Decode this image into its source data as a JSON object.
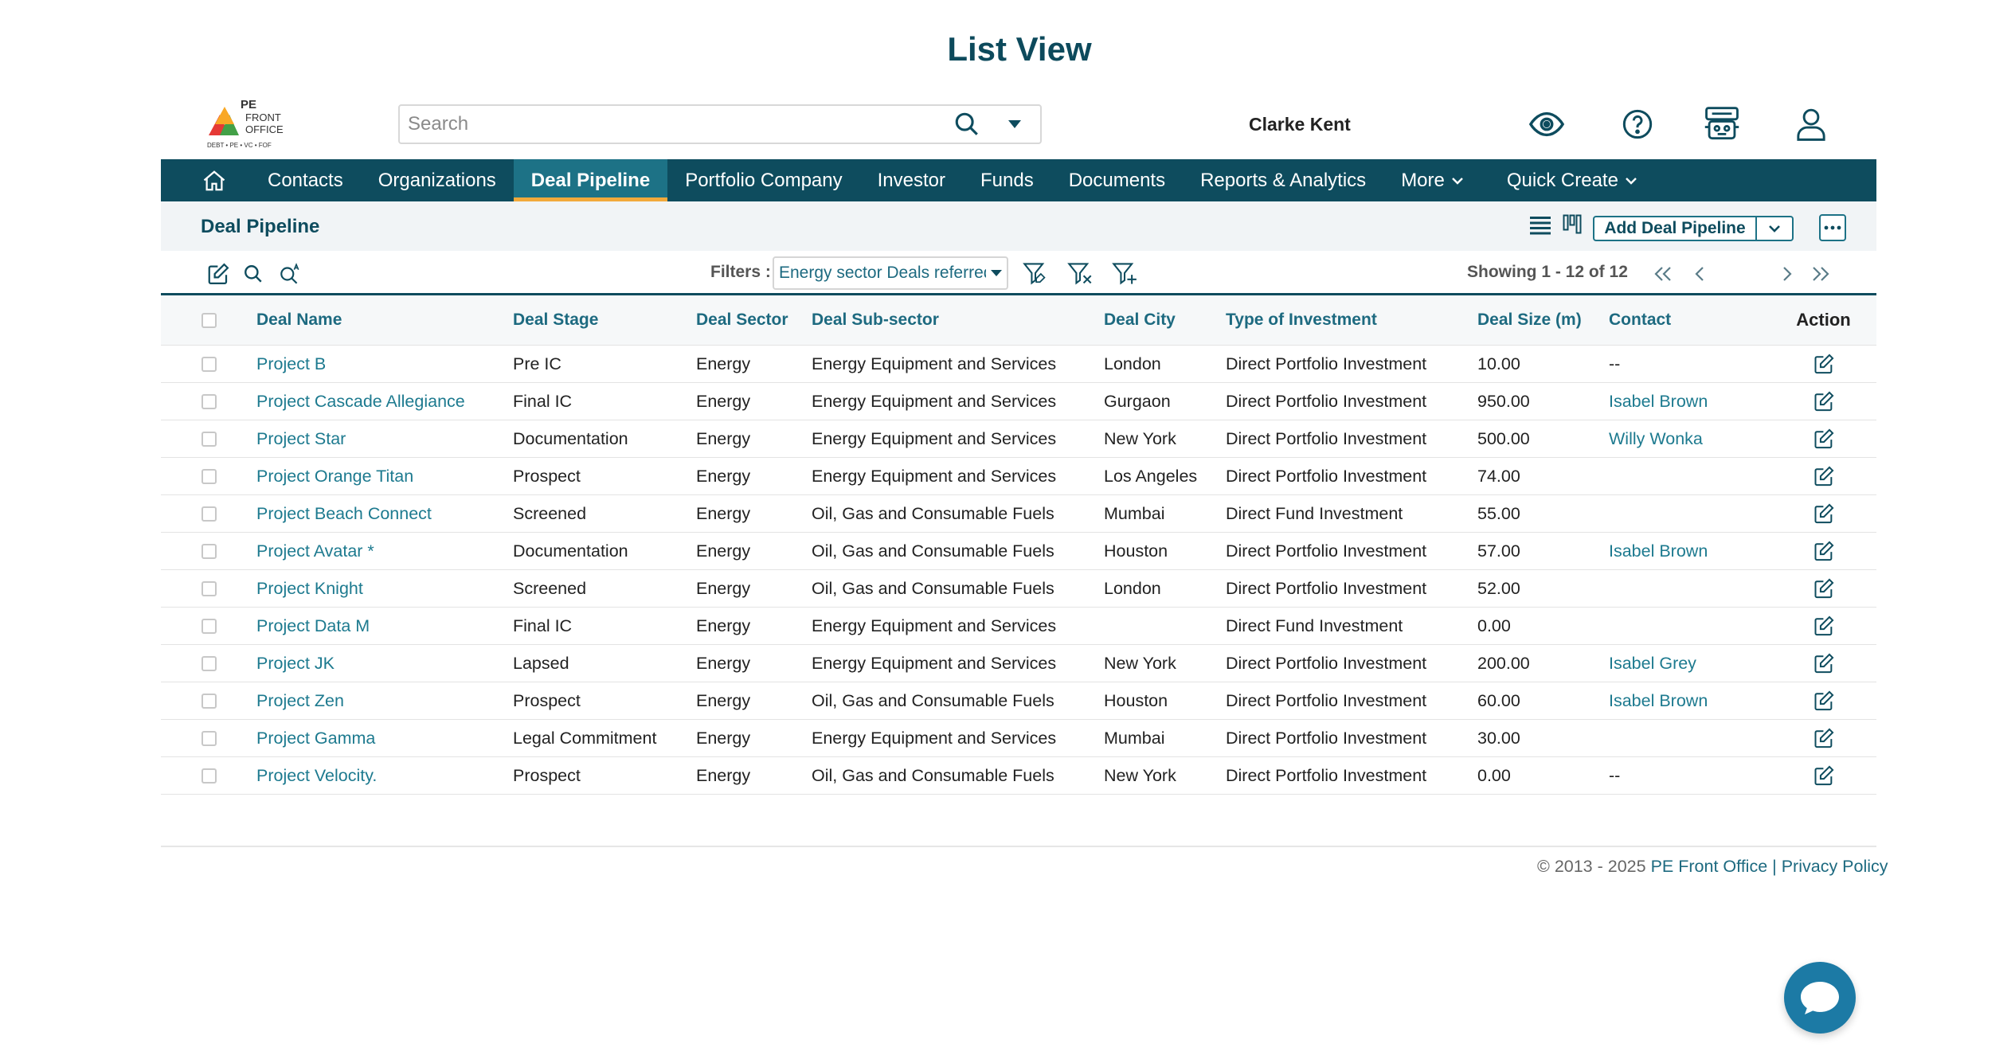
{
  "page": {
    "title": "List View"
  },
  "header": {
    "logo": {
      "line1": "PE",
      "line2": "FRONT",
      "line3": "OFFICE",
      "tagline": "DEBT • PE • VC • FOF"
    },
    "search": {
      "placeholder": "Search",
      "value": ""
    },
    "user_name": "Clarke Kent",
    "icons": [
      "eye-icon",
      "help-icon",
      "robot-icon",
      "user-icon"
    ]
  },
  "nav": {
    "items": [
      {
        "label": "Contacts"
      },
      {
        "label": "Organizations"
      },
      {
        "label": "Deal Pipeline",
        "active": true
      },
      {
        "label": "Portfolio Company"
      },
      {
        "label": "Investor"
      },
      {
        "label": "Funds"
      },
      {
        "label": "Documents"
      },
      {
        "label": "Reports & Analytics"
      },
      {
        "label": "More"
      },
      {
        "label": "Quick Create"
      }
    ]
  },
  "section": {
    "title": "Deal Pipeline",
    "add_button": "Add Deal Pipeline"
  },
  "toolbar": {
    "filters_label": "Filters :",
    "filter_value": "Energy sector Deals referred",
    "showing": "Showing 1 - 12 of 12"
  },
  "table": {
    "columns": [
      "Deal Name",
      "Deal Stage",
      "Deal Sector",
      "Deal Sub-sector",
      "Deal City",
      "Type of Investment",
      "Deal Size (m)",
      "Contact",
      "Action"
    ],
    "rows": [
      [
        "Project B",
        "Pre IC",
        "Energy",
        "Energy Equipment and Services",
        "London",
        "Direct Portfolio Investment",
        "10.00",
        "--"
      ],
      [
        "Project Cascade Allegiance",
        "Final IC",
        "Energy",
        "Energy Equipment and Services",
        "Gurgaon",
        "Direct Portfolio Investment",
        "950.00",
        "Isabel Brown"
      ],
      [
        "Project Star",
        "Documentation",
        "Energy",
        "Energy Equipment and Services",
        "New York",
        "Direct Portfolio Investment",
        "500.00",
        "Willy Wonka"
      ],
      [
        "Project Orange Titan",
        "Prospect",
        "Energy",
        "Energy Equipment and Services",
        "Los Angeles",
        "Direct Portfolio Investment",
        "74.00",
        ""
      ],
      [
        "Project Beach Connect",
        "Screened",
        "Energy",
        "Oil, Gas and Consumable Fuels",
        "Mumbai",
        "Direct Fund Investment",
        "55.00",
        ""
      ],
      [
        "Project Avatar *",
        "Documentation",
        "Energy",
        "Oil, Gas and Consumable Fuels",
        "Houston",
        "Direct Portfolio Investment",
        "57.00",
        "Isabel Brown"
      ],
      [
        "Project Knight",
        "Screened",
        "Energy",
        "Oil, Gas and Consumable Fuels",
        "London",
        "Direct Portfolio Investment",
        "52.00",
        ""
      ],
      [
        "Project Data M",
        "Final IC",
        "Energy",
        "Energy Equipment and Services",
        "",
        "Direct Fund Investment",
        "0.00",
        ""
      ],
      [
        "Project JK",
        "Lapsed",
        "Energy",
        "Energy Equipment and Services",
        "New York",
        "Direct Portfolio Investment",
        "200.00",
        "Isabel Grey"
      ],
      [
        "Project Zen",
        "Prospect",
        "Energy",
        "Oil, Gas and Consumable Fuels",
        "Houston",
        "Direct Portfolio Investment",
        "60.00",
        "Isabel Brown"
      ],
      [
        "Project Gamma",
        "Legal Commitment",
        "Energy",
        "Energy Equipment and Services",
        "Mumbai",
        "Direct Portfolio Investment",
        "30.00",
        ""
      ],
      [
        "Project Velocity.",
        "Prospect",
        "Energy",
        "Oil, Gas and Consumable Fuels",
        "New York",
        "Direct Portfolio Investment",
        "0.00",
        "--"
      ]
    ]
  },
  "footer": {
    "copyright": "© 2013 - 2025",
    "company": "PE Front Office",
    "separator": "|",
    "privacy": "Privacy Policy"
  },
  "colors": {
    "nav_bg": "#0e4c5e",
    "nav_active": "#1d7286",
    "nav_active_underline": "#f2a93b",
    "link": "#1d7a8f",
    "chat": "#1c7aa5"
  }
}
